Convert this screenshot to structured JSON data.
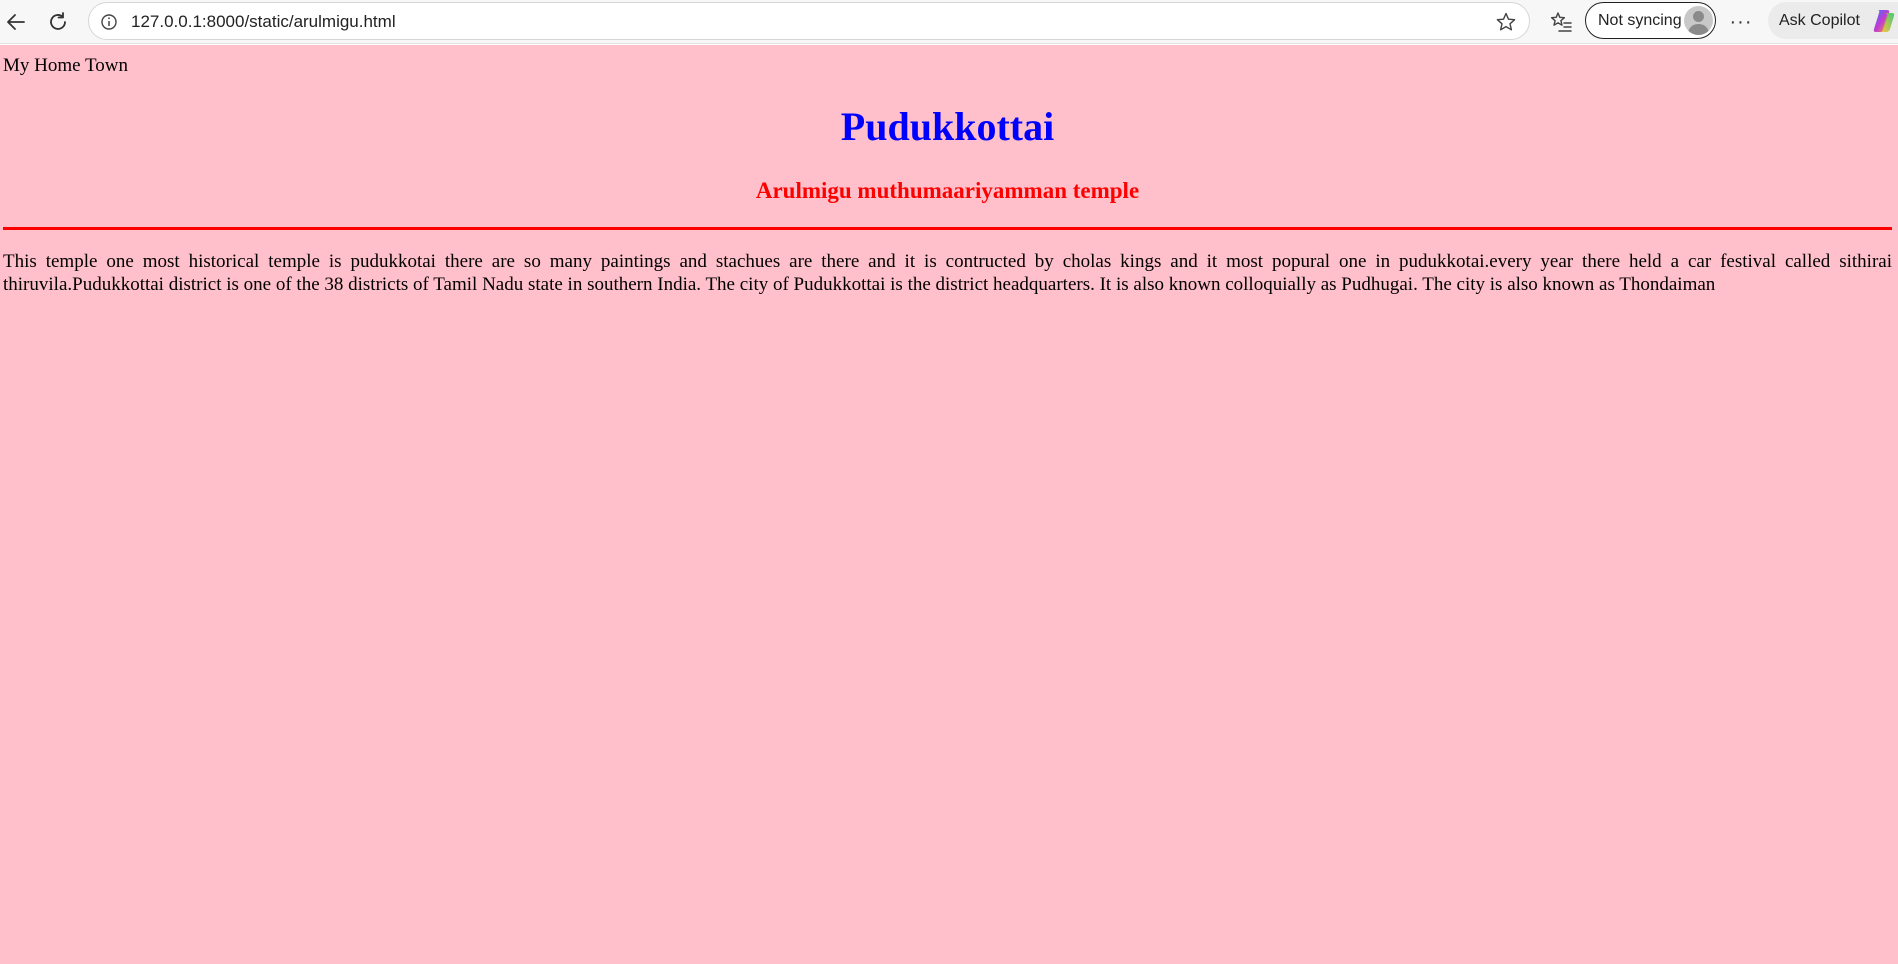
{
  "browser": {
    "url": "127.0.0.1:8000/static/arulmigu.html",
    "sync_label": "Not syncing",
    "copilot_label": "Ask Copilot",
    "more_label": "···"
  },
  "page": {
    "background_color": "#ffc0cb",
    "home_town_label": "My Home Town",
    "title": "Pudukkottai",
    "title_color": "#0000ff",
    "subtitle": "Arulmigu muthumaariyamman temple",
    "subtitle_color": "#ff0000",
    "divider_color": "#ff0000",
    "paragraph": "This temple one most historical temple is pudukkotai there are so many paintings and stachues are there and it is contructed by cholas kings and it most popural one in pudukkotai.every year there held a car festival called sithirai thiruvila.Pudukkottai district is one of the 38 districts of Tamil Nadu state in southern India. The city of Pudukkottai is the district headquarters. It is also known colloquially as Pudhugai. The city is also known as Thondaiman"
  },
  "icons": {
    "back": "back-arrow-icon",
    "reload": "reload-icon",
    "info": "info-icon",
    "star": "star-icon",
    "favorites": "favorites-icon",
    "avatar": "avatar-icon",
    "copilot": "copilot-icon"
  }
}
